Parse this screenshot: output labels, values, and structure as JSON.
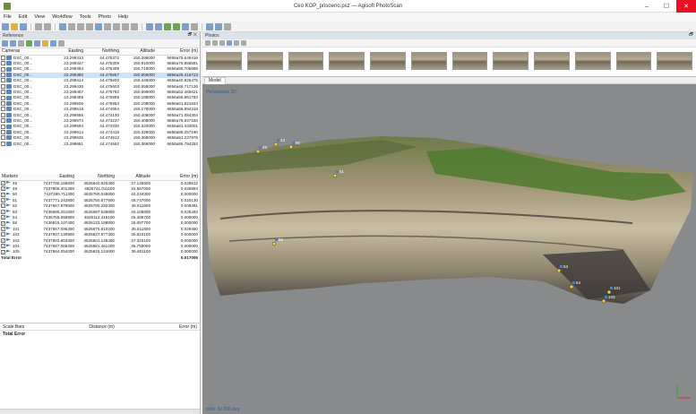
{
  "window": {
    "title": "Ceo KOP_prisoeno.psz — Agisoft PhotoScan",
    "minimize": "–",
    "maximize": "☐",
    "close": "✕"
  },
  "menu": [
    "File",
    "Edit",
    "View",
    "Workflow",
    "Tools",
    "Photo",
    "Help"
  ],
  "reference_panel": {
    "title": "Reference",
    "controls": "🗗 ✕",
    "cameras_columns": [
      "Cameras",
      "Easting",
      "Northing",
      "Altitude",
      "Error (m)"
    ],
    "cameras": [
      {
        "name": "DSC_00...",
        "easting": "23.299313",
        "northing": "44.475372",
        "altitude": "150.398000",
        "error": "6656a75.646416"
      },
      {
        "name": "DSC_00...",
        "easting": "23.299347",
        "northing": "44.475309",
        "altitude": "150.810000",
        "error": "6656a75.856561"
      },
      {
        "name": "DSC_00...",
        "easting": "23.299364",
        "northing": "44.475408",
        "altitude": "150.719000",
        "error": "6656a55.705688"
      },
      {
        "name": "DSC_00...",
        "easting": "23.299380",
        "northing": "44.475657",
        "altitude": "150.559000",
        "error": "6656a25.416723"
      },
      {
        "name": "DSC_00...",
        "easting": "23.299414",
        "northing": "44.475600",
        "altitude": "150.446000",
        "error": "6656a40.825475"
      },
      {
        "name": "DSC_00...",
        "easting": "23.299430",
        "northing": "44.475603",
        "altitude": "150.558000",
        "error": "6656a46.717126"
      },
      {
        "name": "DSC_00...",
        "easting": "23.299467",
        "northing": "44.475782",
        "altitude": "150.699000",
        "error": "6656a52.465621"
      },
      {
        "name": "DSC_00...",
        "easting": "23.299488",
        "northing": "44.475688",
        "altitude": "150.188000",
        "error": "6656a56.961783"
      },
      {
        "name": "DSC_00...",
        "easting": "23.299506",
        "northing": "44.475953",
        "altitude": "150.108000",
        "error": "6656a61.821843"
      },
      {
        "name": "DSC_00...",
        "easting": "23.299518",
        "northing": "44.474654",
        "altitude": "150.178000",
        "error": "6656a66.894318"
      },
      {
        "name": "DSC_00...",
        "easting": "23.299555",
        "northing": "44.474130",
        "altitude": "150.408000",
        "error": "6656a71.084304"
      },
      {
        "name": "DSC_00...",
        "easting": "23.299574",
        "northing": "44.474237",
        "altitude": "150.408000",
        "error": "6656a76.647150"
      },
      {
        "name": "DSC_00...",
        "easting": "23.299594",
        "northing": "44.474330",
        "altitude": "150.320000",
        "error": "6656a81.433001"
      },
      {
        "name": "DSC_00...",
        "easting": "23.299614",
        "northing": "44.474418",
        "altitude": "150.328000",
        "error": "6656a86.257190"
      },
      {
        "name": "DSC_00...",
        "easting": "23.299635",
        "northing": "44.474512",
        "altitude": "150.368000",
        "error": "6656a91.227976"
      },
      {
        "name": "DSC_00...",
        "easting": "23.299651",
        "northing": "44.474592",
        "altitude": "150.368000",
        "error": "6656a95.794253"
      }
    ],
    "markers_columns": [
      "Markers",
      "Easting",
      "Northing",
      "Altitude",
      "Error (m)"
    ],
    "markers": [
      {
        "name": "48",
        "easting": "7437785.156800",
        "northing": "4825640.920300",
        "altitude": "37.145500",
        "error": "0.025612"
      },
      {
        "name": "49",
        "easting": "7437806.401300",
        "northing": "4825741.011100",
        "altitude": "34.567000",
        "error": "0.025894"
      },
      {
        "name": "50",
        "easting": "7437289.711300",
        "northing": "4825780.048800",
        "altitude": "40.234300",
        "error": "0.000000"
      },
      {
        "name": "51",
        "easting": "7437771.242800",
        "northing": "4825750.877900",
        "altitude": "48.747000",
        "error": "0.020130"
      },
      {
        "name": "52",
        "easting": "7437667.979500",
        "northing": "4825780.292300",
        "altitude": "46.611600",
        "error": "0.008491"
      },
      {
        "name": "53",
        "easting": "7436685.251800",
        "northing": "4826087.539800",
        "altitude": "40.106800",
        "error": "0.025493"
      },
      {
        "name": "54",
        "easting": "7436755.068800",
        "northing": "4826112.419100",
        "altitude": "25.486700",
        "error": "0.000000"
      },
      {
        "name": "55",
        "easting": "7436815.107400",
        "northing": "4826133.188800",
        "altitude": "26.057700",
        "error": "0.000000"
      },
      {
        "name": "101",
        "easting": "7437667.096300",
        "northing": "4825675.810200",
        "altitude": "35.611800",
        "error": "0.029450"
      },
      {
        "name": "102",
        "easting": "7437607.130900",
        "northing": "4825637.977300",
        "altitude": "35.823100",
        "error": "0.000000"
      },
      {
        "name": "103",
        "easting": "7437603.903300",
        "northing": "4825601.145400",
        "altitude": "37.323100",
        "error": "0.000000"
      },
      {
        "name": "104",
        "easting": "7437687.065400",
        "northing": "4825581.461200",
        "altitude": "36.755000",
        "error": "0.000000"
      },
      {
        "name": "105",
        "easting": "7437684.054000",
        "northing": "4825625.124600",
        "altitude": "36.801100",
        "error": "0.000000"
      }
    ],
    "markers_total_label": "Total Error",
    "markers_total_value": "0.017005",
    "scale_bars_label": "Scale Bars",
    "distance_label": "Distance (m)",
    "scale_error_label": "Error (m)",
    "scale_total_label": "Total Error"
  },
  "photos_panel": {
    "title": "Photos",
    "controls": "🗗",
    "thumbnail_count": 12
  },
  "viewport": {
    "tab_label": "Model",
    "perspective_label": "Perspective 30°",
    "status": "orbit: 30.000 deg",
    "marker_labels": [
      "43",
      "49",
      "50",
      "51",
      "52",
      "53",
      "54",
      "101",
      "103"
    ]
  },
  "colors": {
    "accent": "#2a5db0",
    "selected_row": "#cfe3f7",
    "viewport_bg": "#888a8c",
    "close": "#e81123"
  }
}
